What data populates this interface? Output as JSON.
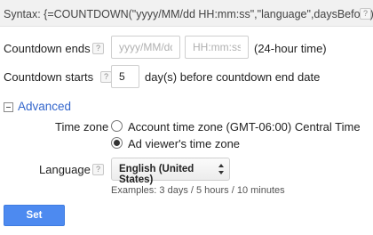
{
  "syntax": {
    "text": "Syntax: {=COUNTDOWN(\"yyyy/MM/dd HH:mm:ss\",\"language\",daysBefore)}",
    "help": "?"
  },
  "countdown_ends": {
    "label": "Countdown ends",
    "help": "?",
    "date_placeholder": "yyyy/MM/dd",
    "time_placeholder": "HH:mm:ss",
    "time_note": "(24-hour time)"
  },
  "countdown_starts": {
    "label": "Countdown starts",
    "help": "?",
    "days_value": "5",
    "suffix": "day(s) before countdown end date"
  },
  "advanced": {
    "label": "Advanced",
    "time_zone_label": "Time zone",
    "options": [
      {
        "label": "Account time zone (GMT-06:00) Central Time",
        "checked": false
      },
      {
        "label": "Ad viewer's time zone",
        "checked": true
      }
    ],
    "language_label": "Language",
    "language_help": "?",
    "language_value": "English (United States)",
    "examples": "Examples: 3 days / 5 hours / 10 minutes"
  },
  "set_button": "Set",
  "colors": {
    "link": "#3366cc",
    "primary_button": "#4d8af0"
  }
}
